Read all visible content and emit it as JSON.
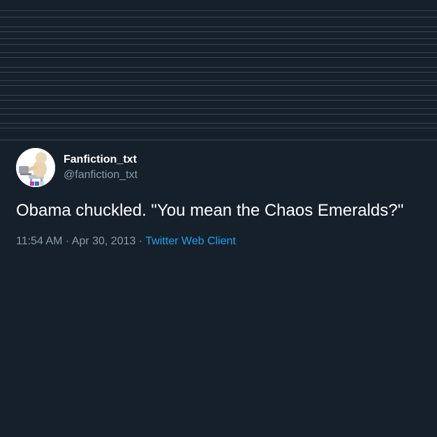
{
  "tweet": {
    "display_name": "Fanfiction_txt",
    "handle": "@fanfiction_txt",
    "text": "Obama chuckled. \"You mean the Chaos Emeralds?\"",
    "time": "11:54 AM",
    "separator": "·",
    "date": "Apr 30, 2013",
    "source": "Twitter Web Client"
  },
  "colors": {
    "background": "#15202b",
    "text_primary": "#ffffff",
    "text_secondary": "#8899a6",
    "link": "#1da1f2",
    "rule": "#38444d"
  },
  "icons": {
    "avatar": "figure-at-laptop-avatar"
  }
}
